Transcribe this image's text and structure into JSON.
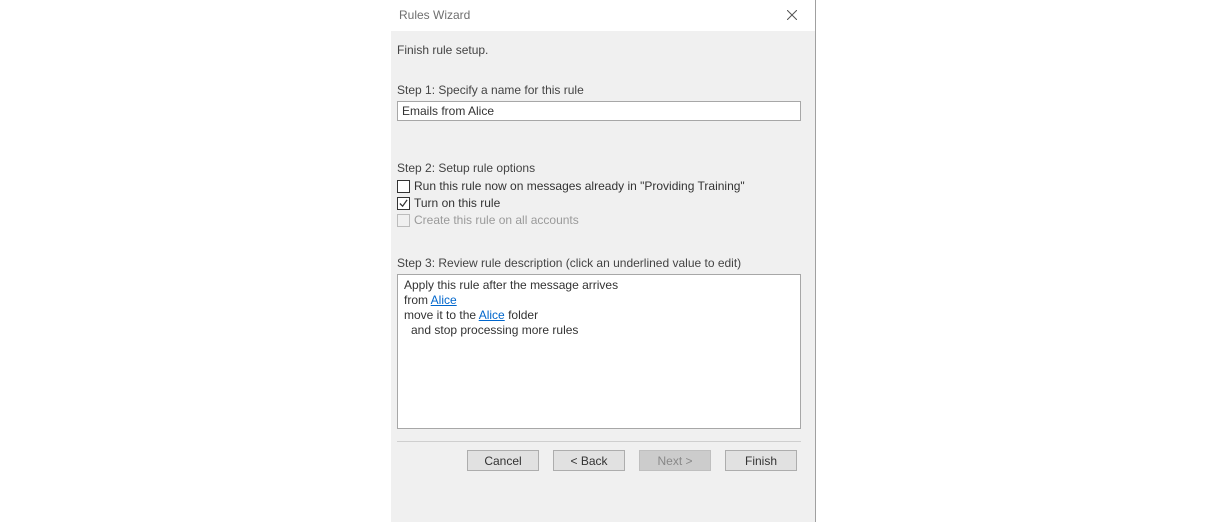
{
  "title": "Rules Wizard",
  "subtitle": "Finish rule setup.",
  "step1": {
    "label": "Step 1: Specify a name for this rule",
    "value": "Emails from Alice"
  },
  "step2": {
    "label": "Step 2: Setup rule options",
    "options": [
      {
        "label": "Run this rule now on messages already in \"Providing Training\"",
        "checked": false,
        "disabled": false
      },
      {
        "label": "Turn on this rule",
        "checked": true,
        "disabled": false
      },
      {
        "label": "Create this rule on all accounts",
        "checked": false,
        "disabled": true
      }
    ]
  },
  "step3": {
    "label": "Step 3: Review rule description (click an underlined value to edit)",
    "line1": "Apply this rule after the message arrives",
    "line2_pre": "from ",
    "line2_link": "Alice",
    "line3_pre": "move it to the ",
    "line3_link": "Alice",
    "line3_post": " folder",
    "line4": "and stop processing more rules"
  },
  "footer": {
    "cancel": "Cancel",
    "back": "< Back",
    "next": "Next >",
    "finish": "Finish"
  }
}
